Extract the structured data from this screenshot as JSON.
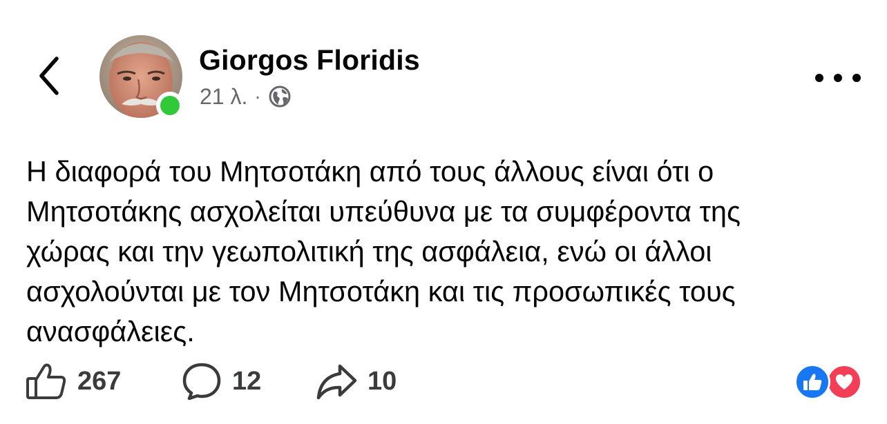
{
  "header": {
    "author_name": "Giorgos Floridis",
    "timestamp": "21 λ.",
    "separator": "·",
    "privacy_icon": "globe-icon",
    "back_icon": "chevron-left-icon",
    "more_icon": "more-horizontal-icon",
    "presence_color": "#31c93a"
  },
  "post": {
    "lines": [
      "Η διαφορά του Μητσοτάκη από τους άλλους είναι ότι ο",
      "Μητσοτάκης ασχολείται υπεύθυνα με τα συμφέροντα της",
      "χώρας και την γεωπολιτική της ασφάλεια, ενώ οι άλλοι",
      "ασχολούνται με τον Μητσοτάκη και τις προσωπικές τους",
      "ανασφάλειες."
    ]
  },
  "actions": {
    "likes": "267",
    "comments": "12",
    "shares": "10",
    "like_icon": "thumbs-up-icon",
    "comment_icon": "comment-bubble-icon",
    "share_icon": "share-arrow-icon"
  },
  "reactions": [
    {
      "icon": "like-reaction-icon",
      "color": "#1877f2"
    },
    {
      "icon": "love-reaction-icon",
      "color": "#f33e58"
    }
  ]
}
